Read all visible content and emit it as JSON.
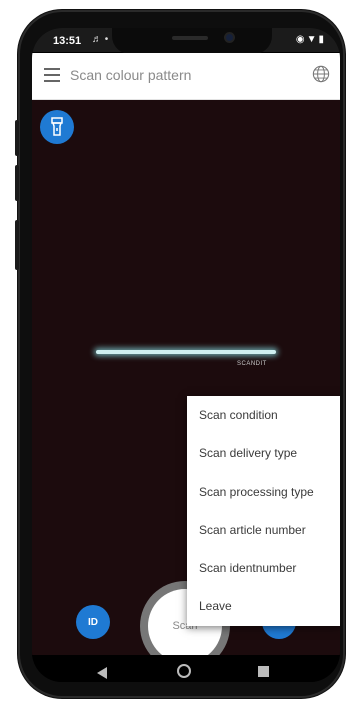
{
  "status_bar": {
    "time": "13:51"
  },
  "app_bar": {
    "title": "Scan colour pattern"
  },
  "camera": {
    "brand_text": "SCANDIT"
  },
  "menu": {
    "items": [
      {
        "label": "Scan condition"
      },
      {
        "label": "Scan delivery type"
      },
      {
        "label": "Scan processing type"
      },
      {
        "label": "Scan article number"
      },
      {
        "label": "Scan identnumber"
      },
      {
        "label": "Leave"
      }
    ]
  },
  "controls": {
    "id_label": "ID",
    "scan_label": "Scan",
    "more_label": "•••"
  },
  "colors": {
    "accent": "#1f7ad3",
    "camera_bg": "#1c0b0d",
    "scan_line": "#cfeff0"
  },
  "icons": {
    "menu": "hamburger-icon",
    "language": "globe-icon",
    "flash": "flashlight-icon",
    "more": "more-dots-icon",
    "nav_back": "back-icon",
    "nav_home": "home-icon",
    "nav_recent": "recent-apps-icon"
  }
}
